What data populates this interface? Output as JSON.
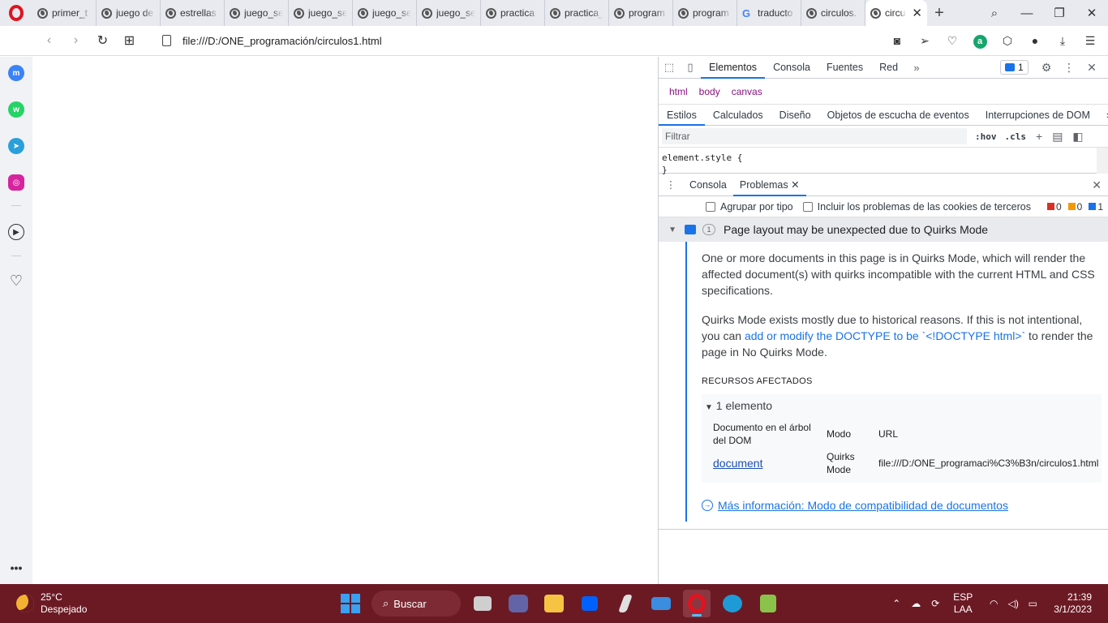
{
  "browser": {
    "tabs": [
      {
        "title": "primer_t"
      },
      {
        "title": "juego de"
      },
      {
        "title": "estrellas"
      },
      {
        "title": "juego_se"
      },
      {
        "title": "juego_se"
      },
      {
        "title": "juego_se"
      },
      {
        "title": "juego_se"
      },
      {
        "title": "practica"
      },
      {
        "title": "practica_"
      },
      {
        "title": "program"
      },
      {
        "title": "program"
      },
      {
        "title": "traducto",
        "icon": "google-icon"
      },
      {
        "title": "circulos."
      }
    ],
    "active_tab": {
      "title": "circu"
    },
    "address": "file:///D:/ONE_programación/circulos1.html"
  },
  "devtools": {
    "tabs": [
      "Elementos",
      "Consola",
      "Fuentes",
      "Red"
    ],
    "issues_badge": "1",
    "breadcrumbs": [
      "html",
      "body",
      "canvas"
    ],
    "subtabs": [
      "Estilos",
      "Calculados",
      "Diseño",
      "Objetos de escucha de eventos",
      "Interrupciones de DOM"
    ],
    "filter_placeholder": "Filtrar",
    "hov": ":hov",
    "cls": ".cls",
    "style_line1": "element.style {",
    "style_line2": "}",
    "drawer_tabs": [
      "Consola",
      "Problemas"
    ],
    "group_by_type": "Agrupar por tipo",
    "include_cookies": "Incluir los problemas de las cookies de terceros",
    "counts": {
      "errors": "0",
      "warnings": "0",
      "info": "1"
    },
    "issue": {
      "count": "1",
      "title": "Page layout may be unexpected due to Quirks Mode",
      "para1": "One or more documents in this page is in Quirks Mode, which will render the affected document(s) with quirks incompatible with the current HTML and CSS specifications.",
      "para2_pre": "Quirks Mode exists mostly due to historical reasons. If this is not intentional, you can ",
      "para2_link": "add or modify the DOCTYPE to be `<!DOCTYPE html>`",
      "para2_post": " to render the page in No Quirks Mode.",
      "resources_label": "RECURSOS AFECTADOS",
      "elements_title": "1 elemento",
      "col_doc": "Documento en el árbol del DOM",
      "col_mode": "Modo",
      "col_url": "URL",
      "row_doc": "document",
      "row_mode": "Quirks Mode",
      "row_url": "file:///D:/ONE_programaci%C3%B3n/circulos1.html",
      "more_link": "Más información: Modo de compatibilidad de documentos"
    }
  },
  "taskbar": {
    "temp": "25°C",
    "weather": "Despejado",
    "search": "Buscar",
    "lang1": "ESP",
    "lang2": "LAA",
    "time": "21:39",
    "date": "3/1/2023"
  },
  "colors": {
    "opera_red": "#e0131f",
    "taskbar": "#6b1a24",
    "devtools_accent": "#1a73e8"
  }
}
